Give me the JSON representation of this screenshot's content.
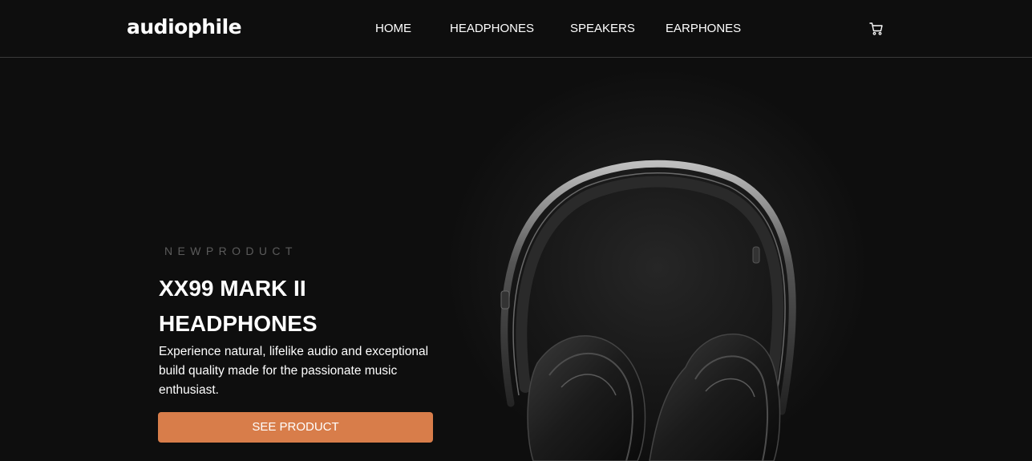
{
  "header": {
    "logo_text": "audiophile",
    "nav": [
      {
        "label": "HOME"
      },
      {
        "label": "HEADPHONES"
      },
      {
        "label": "SPEAKERS"
      },
      {
        "label": "EARPHONES"
      }
    ],
    "cart_icon": "cart-icon"
  },
  "hero": {
    "overline": "NEWPRODUCT",
    "title_line1": "XX99 MARK II",
    "title_line2": "HEADPHONES",
    "description": "Experience natural, lifelike audio and exceptional build quality made for the passionate music enthusiast.",
    "cta_label": "SEE PRODUCT",
    "image_icon": "headphones-image"
  },
  "colors": {
    "background": "#0e0e0e",
    "accent": "#d87d4a",
    "text": "#ffffff",
    "overline": "#5b5b5b"
  }
}
